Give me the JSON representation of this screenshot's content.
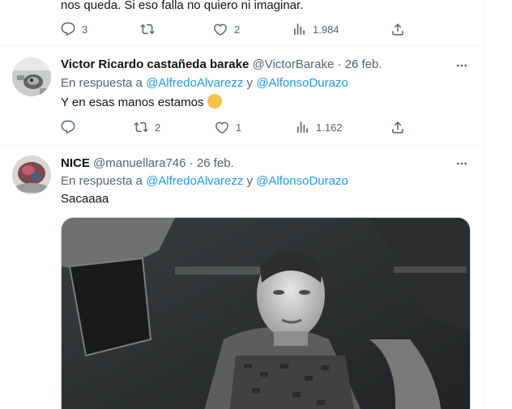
{
  "prev_tweet": {
    "text": "nos queda. Si eso falla no quiero ni imaginar.",
    "replies": "3",
    "retweets": "",
    "likes": "2",
    "views": "1.984"
  },
  "tweet1": {
    "name": "Victor Ricardo castañeda barake",
    "handle": "@VictorBarake",
    "sep": "·",
    "date": "26 feb.",
    "reply_prefix": "En respuesta a",
    "mention1": "@AlfredoAlvarezz",
    "reply_and": "y",
    "mention2": "@AlfonsoDurazo",
    "text": "Y en esas manos estamos",
    "emoji": "😬",
    "replies": "",
    "retweets": "2",
    "likes": "1",
    "views": "1.162"
  },
  "tweet2": {
    "name": "NICE",
    "handle": "@manuellara746",
    "sep": "·",
    "date": "26 feb.",
    "reply_prefix": "En respuesta a",
    "mention1": "@AlfredoAlvarezz",
    "reply_and": "y",
    "mention2": "@AlfonsoDurazo",
    "text": "Sacaaaa"
  },
  "colors": {
    "accent": "#1d9bf0",
    "muted": "#536471",
    "text": "#0f1419"
  }
}
